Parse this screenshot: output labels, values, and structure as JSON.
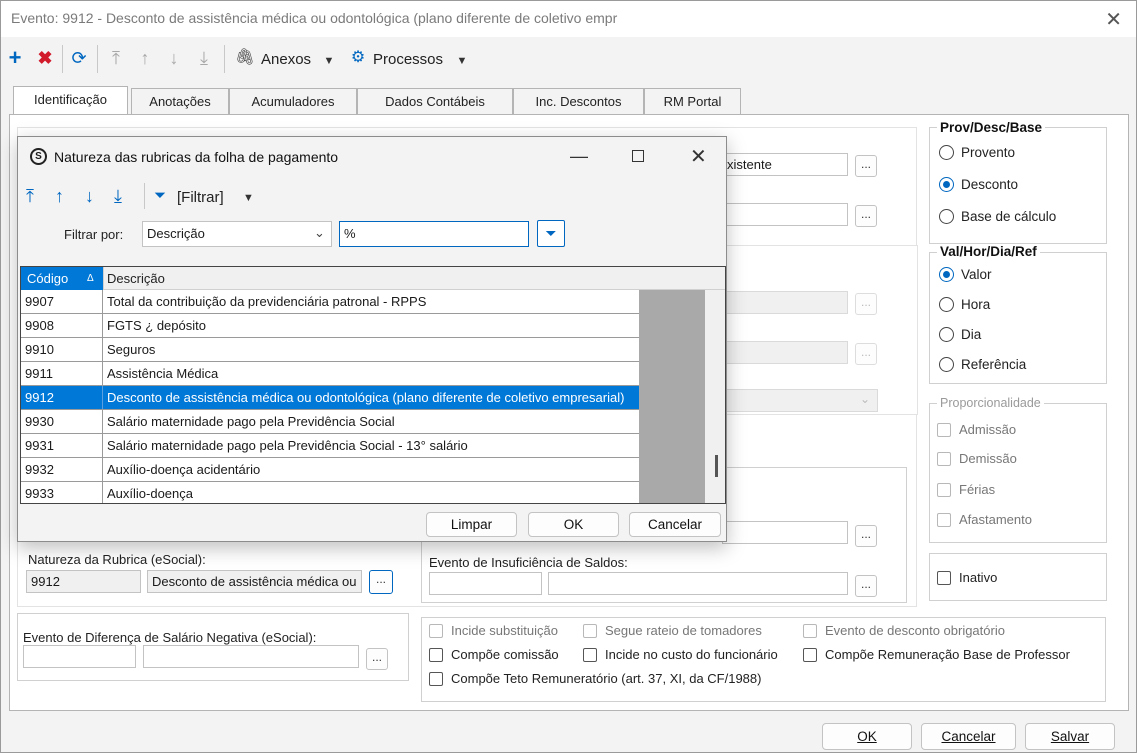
{
  "window": {
    "title": "Evento: 9912 - Desconto de assistência médica ou odontológica (plano diferente de coletivo empr",
    "close": "✕"
  },
  "toolbar": {
    "attachments_label": "Anexos",
    "processes_label": "Processos"
  },
  "tabs": [
    "Identificação",
    "Anotações",
    "Acumuladores",
    "Dados Contábeis",
    "Inc. Descontos",
    "RM Portal"
  ],
  "prov_group": {
    "title": "Prov/Desc/Base",
    "options": [
      "Provento",
      "Desconto",
      "Base de cálculo"
    ],
    "selected": "Desconto"
  },
  "val_group": {
    "title": "Val/Hor/Dia/Ref",
    "options": [
      "Valor",
      "Hora",
      "Dia",
      "Referência"
    ],
    "selected": "Valor"
  },
  "prop_group": {
    "title": "Proporcionalidade",
    "options": [
      "Admissão",
      "Demissão",
      "Férias",
      "Afastamento"
    ]
  },
  "inativo_label": "Inativo",
  "behind_text": "xistente",
  "natureza": {
    "label": "Natureza da Rubrica (eSocial):",
    "code": "9912",
    "description": "Desconto de assistência médica ou"
  },
  "insuficiencia_label": "Evento de Insuficiência de Saldos:",
  "diferenca_label": "Evento de Diferença de Salário Negativa (eSocial):",
  "checks": {
    "incide_substituicao": "Incide substituição",
    "segue_rateio": "Segue rateio de tomadores",
    "evento_desconto_obrigatorio": "Evento de desconto obrigatório",
    "compoe_comissao": "Compõe comissão",
    "incide_custo": "Incide no custo do funcionário",
    "compoe_remuneracao_professor": "Compõe Remuneração Base de Professor",
    "compoe_teto": "Compõe Teto Remuneratório (art. 37, XI, da CF/1988)"
  },
  "footer": {
    "ok": "OK",
    "cancel": "Cancelar",
    "save": "Salvar"
  },
  "dialog": {
    "title": "Natureza das rubricas da folha de pagamento",
    "filter_label": "[Filtrar]",
    "filter_by_label": "Filtrar por:",
    "filter_field": "Descrição",
    "filter_value": "%",
    "columns": {
      "code": "Código",
      "description": "Descrição"
    },
    "rows": [
      {
        "code": "9907",
        "description": "Total da contribuição da previdenciária patronal - RPPS"
      },
      {
        "code": "9908",
        "description": "FGTS ¿ depósito"
      },
      {
        "code": "9910",
        "description": "Seguros"
      },
      {
        "code": "9911",
        "description": "Assistência Médica"
      },
      {
        "code": "9912",
        "description": "Desconto de assistência médica ou odontológica (plano diferente de coletivo empresarial)"
      },
      {
        "code": "9930",
        "description": "Salário maternidade pago pela Previdência Social"
      },
      {
        "code": "9931",
        "description": "Salário maternidade pago pela Previdência Social - 13° salário"
      },
      {
        "code": "9932",
        "description": "Auxílio-doença acidentário"
      },
      {
        "code": "9933",
        "description": "Auxílio-doença"
      }
    ],
    "selected_code": "9912",
    "buttons": {
      "clear": "Limpar",
      "ok": "OK",
      "cancel": "Cancelar"
    }
  },
  "colors": {
    "accent": "#0067c0",
    "selection": "#0078d7",
    "add_icon": "#0067c0",
    "delete_icon": "#d11a2a"
  }
}
